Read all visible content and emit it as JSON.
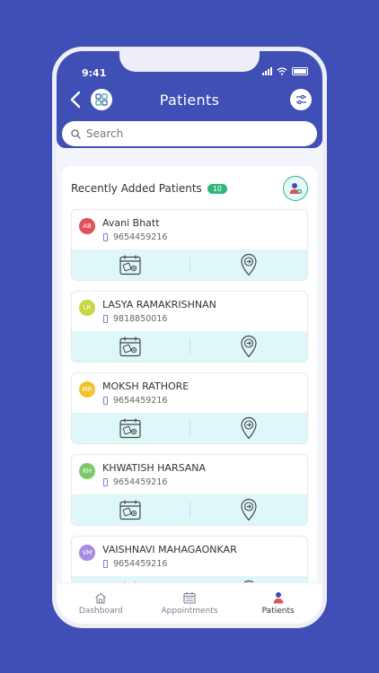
{
  "status_bar": {
    "time": "9:41"
  },
  "header": {
    "title": "Patients"
  },
  "search": {
    "placeholder": "Search"
  },
  "section": {
    "title": "Recently Added Patients",
    "count": "10"
  },
  "colors": {
    "brand": "#3f4fb5",
    "badge": "#2eb87a",
    "action_bg": "#def8f9"
  },
  "patients": [
    {
      "initials": "AB",
      "name": "Avani Bhatt",
      "phone": "9654459216",
      "color": "#e0525b"
    },
    {
      "initials": "LR",
      "name": "LASYA RAMAKRISHNAN",
      "phone": "9818850016",
      "color": "#c7d743"
    },
    {
      "initials": "MR",
      "name": "MOKSH RATHORE",
      "phone": "9654459216",
      "color": "#f2c22e"
    },
    {
      "initials": "KH",
      "name": "KHWATISH HARSANA",
      "phone": "9654459216",
      "color": "#7bc96b"
    },
    {
      "initials": "VM",
      "name": "VAISHNAVI MAHAGAONKAR",
      "phone": "9654459216",
      "color": "#a58de0"
    }
  ],
  "tabs": [
    {
      "label": "Dashboard",
      "icon": "home-icon"
    },
    {
      "label": "Appointments",
      "icon": "calendar-icon"
    },
    {
      "label": "Patients",
      "icon": "patient-icon"
    }
  ]
}
